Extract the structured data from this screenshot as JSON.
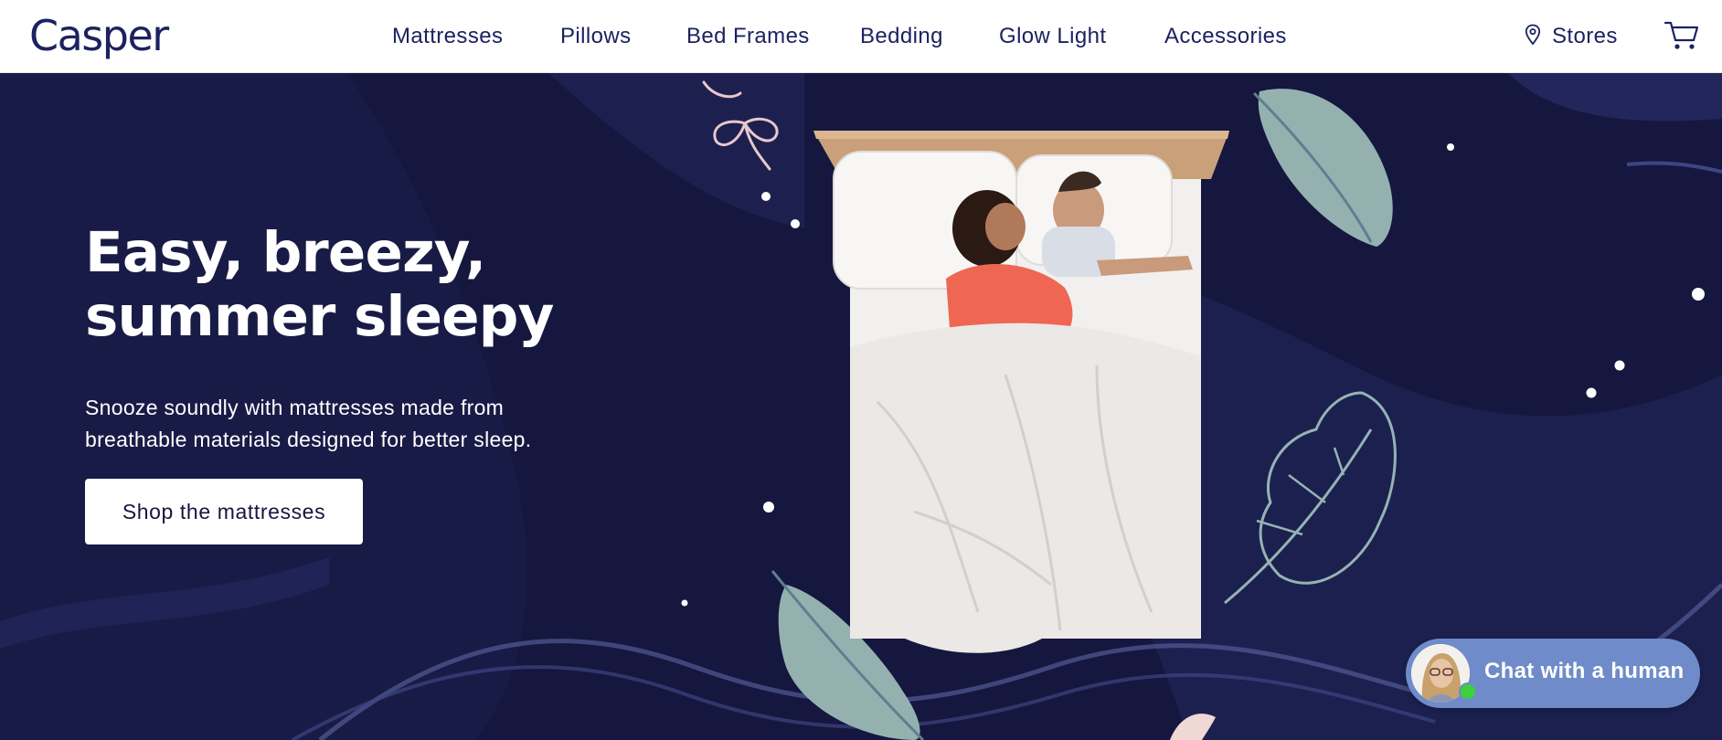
{
  "header": {
    "logo": "Casper",
    "nav": [
      {
        "label": "Mattresses"
      },
      {
        "label": "Pillows"
      },
      {
        "label": "Bed Frames"
      },
      {
        "label": "Bedding"
      },
      {
        "label": "Glow Light"
      },
      {
        "label": "Accessories"
      }
    ],
    "stores_label": "Stores",
    "icons": {
      "stores": "location-pin-icon",
      "cart": "cart-icon"
    }
  },
  "hero": {
    "headline_line1": "Easy, breezy,",
    "headline_line2": "summer sleepy",
    "subtext_line1": "Snooze soundly with mattresses made from",
    "subtext_line2": "breathable materials designed for better sleep.",
    "cta_label": "Shop the mattresses"
  },
  "chat": {
    "label": "Chat with a human",
    "status": "online"
  },
  "colors": {
    "brand_navy": "#1c2260",
    "hero_background": "#15173e",
    "chat_background": "#6f8bc9",
    "status_online": "#3bd13b"
  }
}
